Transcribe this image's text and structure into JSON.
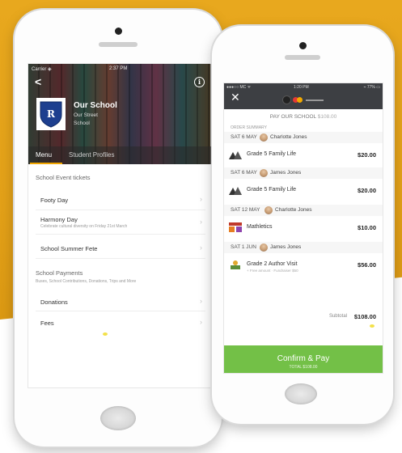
{
  "left_app": {
    "status": {
      "carrier": "Carrier ◈",
      "time": "2:37 PM"
    },
    "school": {
      "name": "Our School",
      "street": "Our Street",
      "sub": "School"
    },
    "tabs": [
      {
        "label": "Menu",
        "active": true
      },
      {
        "label": "Student Profiles",
        "active": false
      }
    ],
    "event_section": {
      "title": "School Event tickets"
    },
    "events": [
      {
        "label": "Footy Day",
        "sub": ""
      },
      {
        "label": "Harmony Day",
        "sub": "Celebrate cultural diversity on Friday 21st March"
      },
      {
        "label": "School Summer Fete",
        "sub": ""
      }
    ],
    "payments_section": {
      "title": "School Payments",
      "sub": "Buses, School Contributions, Donations, Trips and More"
    },
    "payments": [
      {
        "label": "Donations"
      },
      {
        "label": "Fees"
      }
    ]
  },
  "right_app": {
    "status": {
      "carrier": "●●●○○ MC ᯤ",
      "time": "1:20 PM",
      "battery": "⌁ 77% ▭"
    },
    "pay_title": "PAY OUR SCHOOL",
    "pay_amount": "$108.00",
    "order_summary": "ORDER SUMMARY",
    "groups": [
      {
        "date": "SAT 6 MAY",
        "person": "Charlotte  Jones",
        "item": {
          "name": "Grade 5 Family Life",
          "price": "$20.00",
          "icon": "family-icon"
        }
      },
      {
        "date": "SAT 6 MAY",
        "person": "James Jones",
        "item": {
          "name": "Grade 5 Family Life",
          "price": "$20.00",
          "icon": "family-icon"
        }
      },
      {
        "date": "SAT 12 MAY",
        "person": "Charlotte  Jones",
        "item": {
          "name": "Mathletics",
          "price": "$10.00",
          "icon": "mathletics-icon"
        }
      },
      {
        "date": "SAT 1 JUN",
        "person": "James Jones",
        "item": {
          "name": "Grade 2 Author Visit",
          "price": "$56.00",
          "icon": "author-icon",
          "sub": "+ Free amount · Fundraiser $50"
        }
      }
    ],
    "subtotal_label": "Subtotal",
    "subtotal_value": "$108.00",
    "confirm_label": "Confirm & Pay",
    "confirm_sub": "TOTAL $108.00"
  },
  "colors": {
    "accent_orange": "#f0a500",
    "confirm_green": "#73c047",
    "header_dark": "#3d3f43"
  }
}
